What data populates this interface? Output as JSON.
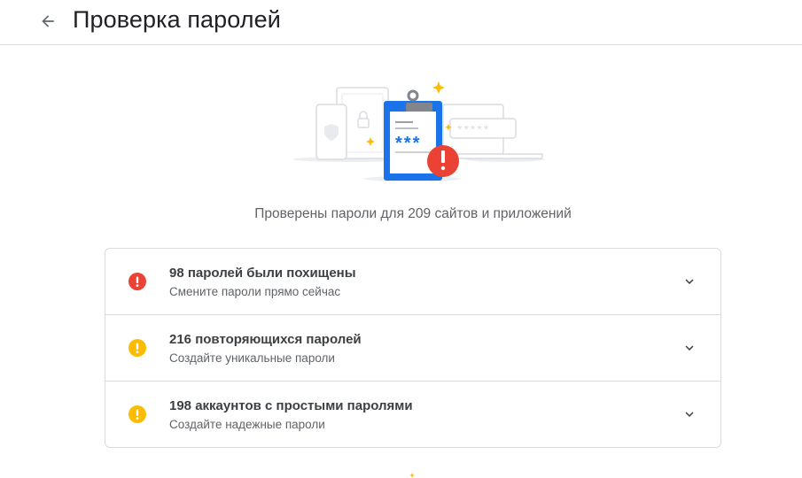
{
  "header": {
    "title": "Проверка паролей"
  },
  "summary": "Проверены пароли для 209 сайтов и приложений",
  "issues": [
    {
      "title": "98 паролей были похищены",
      "subtitle": "Смените пароли прямо сейчас",
      "severity": "error",
      "color": "#ea4335"
    },
    {
      "title": "216 повторяющихся паролей",
      "subtitle": "Создайте уникальные пароли",
      "severity": "warning",
      "color": "#fbbc04"
    },
    {
      "title": "198 аккаунтов с простыми паролями",
      "subtitle": "Создайте надежные пароли",
      "severity": "warning",
      "color": "#fbbc04"
    }
  ],
  "illustration": {
    "masked_password_clipboard": "***",
    "masked_password_laptop": "*****"
  }
}
